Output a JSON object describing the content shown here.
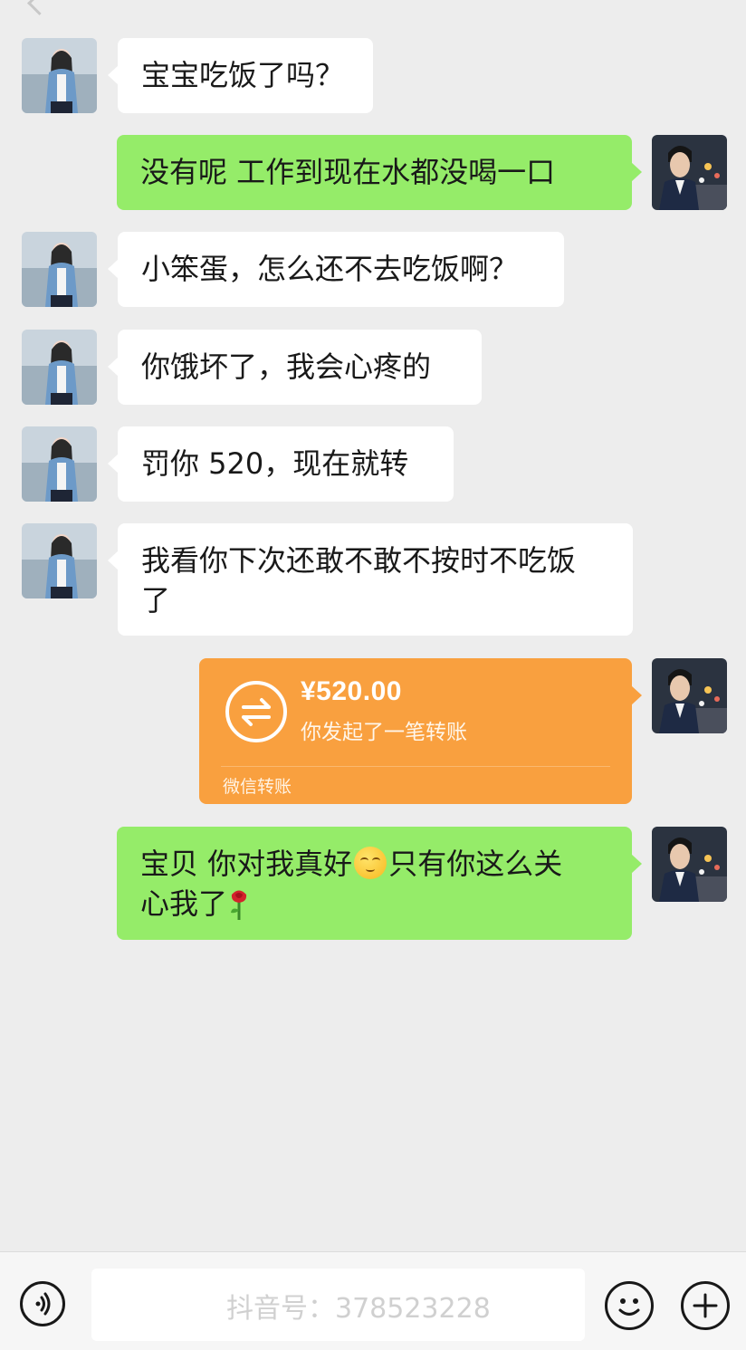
{
  "messages": [
    {
      "side": "left",
      "text": "宝宝吃饭了吗？"
    },
    {
      "side": "right",
      "text": "没有呢 工作到现在水都没喝一口"
    },
    {
      "side": "left",
      "text": "小笨蛋，怎么还不去吃饭啊？"
    },
    {
      "side": "left",
      "text": "你饿坏了，我会心疼的"
    },
    {
      "side": "left",
      "text": "罚你 520，现在就转"
    },
    {
      "side": "left",
      "text_line1": "我看你下次还敢不敢不按时不吃饭",
      "text_line2": "了"
    },
    {
      "side": "right",
      "type": "transfer",
      "amount": "¥520.00",
      "desc": "你发起了一笔转账",
      "footer": "微信转账"
    },
    {
      "side": "right",
      "text_part1": "宝贝 你对我真好",
      "text_part2": "只有你这么关",
      "text_part3": "心我了"
    }
  ],
  "watermark": "抖音号：378523228",
  "colors": {
    "background": "#ededed",
    "incoming_bubble": "#ffffff",
    "outgoing_bubble": "#95ec69",
    "transfer_card": "#f9a03f"
  },
  "icons": {
    "back": "chevron-left-icon",
    "voice": "voice-icon",
    "emoji": "emoji-icon",
    "plus": "plus-icon",
    "transfer": "transfer-arrows-icon"
  }
}
